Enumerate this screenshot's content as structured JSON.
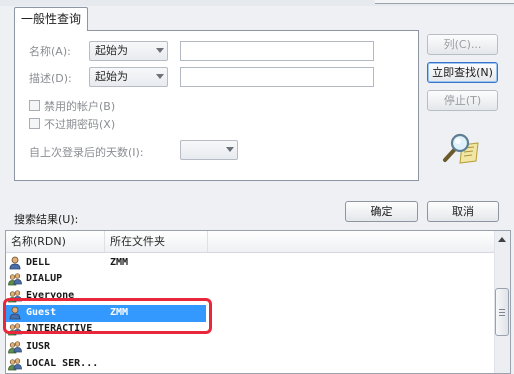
{
  "dialog": {
    "tab_label": "一般性查询",
    "name_label": "名称(A):",
    "name_match": "起始为",
    "name_value": "",
    "desc_label": "描述(D):",
    "desc_match": "起始为",
    "desc_value": "",
    "disabled_accounts_label": "禁用的帐户(B)",
    "no_expire_label": "不过期密码(X)",
    "days_since_logon_label": "自上次登录后的天数(I):",
    "days_since_logon_value": "",
    "buttons": {
      "columns": "列(C)...",
      "find_now": "立即查找(N)",
      "stop": "停止(T)",
      "ok": "确定",
      "cancel": "取消"
    }
  },
  "results": {
    "label": "搜索结果(U):",
    "columns": [
      "名称(RDN)",
      "所在文件夹"
    ],
    "rows": [
      {
        "name": "DELL",
        "folder": "ZMM",
        "icon": "user-icon",
        "selected": false
      },
      {
        "name": "DIALUP",
        "folder": "",
        "icon": "group-icon",
        "selected": false
      },
      {
        "name": "Everyone",
        "folder": "",
        "icon": "group-icon",
        "selected": false
      },
      {
        "name": "Guest",
        "folder": "ZMM",
        "icon": "user-icon",
        "selected": true
      },
      {
        "name": "INTERACTIVE",
        "folder": "",
        "icon": "group-icon",
        "selected": false
      },
      {
        "name": "IUSR",
        "folder": "",
        "icon": "group-icon",
        "selected": false
      },
      {
        "name": "LOCAL SER...",
        "folder": "",
        "icon": "group-icon",
        "selected": false
      }
    ]
  },
  "colors": {
    "selection": "#3399ff",
    "highlight_box": "#e8283a"
  }
}
